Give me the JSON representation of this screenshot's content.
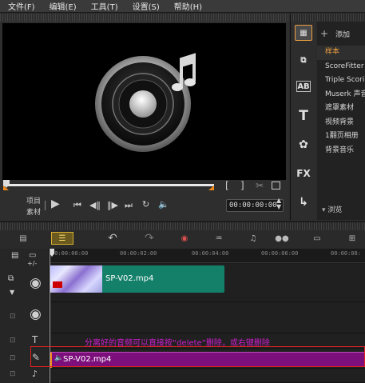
{
  "menu": [
    "文件(F)",
    "编辑(E)",
    "工具(T)",
    "设置(S)",
    "帮助(H)"
  ],
  "player": {
    "mode_project": "项目",
    "mode_clip": "素材",
    "timecode": "00:00:00:00",
    "bracket_in": "[",
    "bracket_out": "]"
  },
  "library": {
    "add_label": "添加",
    "items": [
      "样本",
      "ScoreFitter",
      "Triple Scoring",
      "Muserk 声音",
      "遮罩素材",
      "视频背景",
      "1翻页相册",
      "背景音乐"
    ],
    "selected_index": 0,
    "browse_label": "浏览",
    "tab_icons": [
      "media-icon",
      "transition-icon",
      "title-ab-icon",
      "title-t-icon",
      "graphic-icon",
      "fx-icon",
      "path-icon"
    ]
  },
  "timeline": {
    "ruler_ticks": [
      "00:00:00:00",
      "00:00:02:00",
      "00:00:04:00",
      "00:00:06:00",
      "00:00:08:"
    ],
    "video_clip": "SP-V02.mp4",
    "audio_clip": "SP-V02.mp4",
    "annotation": "分离好的音频可以直接按“delete”删除，或右键删除",
    "annotation_color": "#d11ed1",
    "video_clip_color": "#15806a",
    "audio_clip_color": "#7d0f7d"
  }
}
